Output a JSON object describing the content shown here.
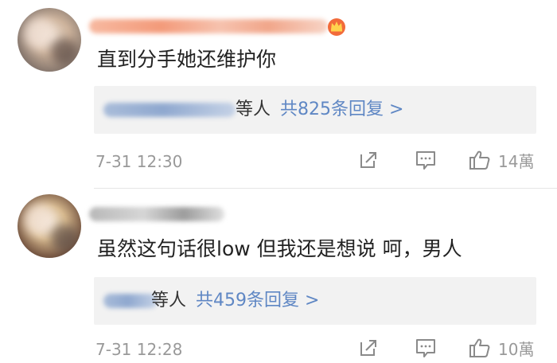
{
  "comments": [
    {
      "text": "直到分手她还维护你",
      "reply_suffix": "等人",
      "reply_count_text": "共825条回复 >",
      "timestamp": "7-31 12:30",
      "likes": "14萬"
    },
    {
      "text": "虽然这句话很low  但我还是想说  呵，男人",
      "reply_suffix": "等人",
      "reply_count_text": "共459条回复 >",
      "timestamp": "7-31 12:28",
      "likes": "10萬"
    }
  ],
  "icons": {
    "vip": "crown-badge-icon",
    "share": "share-icon",
    "comment": "comment-icon",
    "like": "thumbs-up-icon"
  },
  "colors": {
    "link": "#5f87c4",
    "meta": "#999999",
    "reply_bg": "#f2f2f2"
  }
}
